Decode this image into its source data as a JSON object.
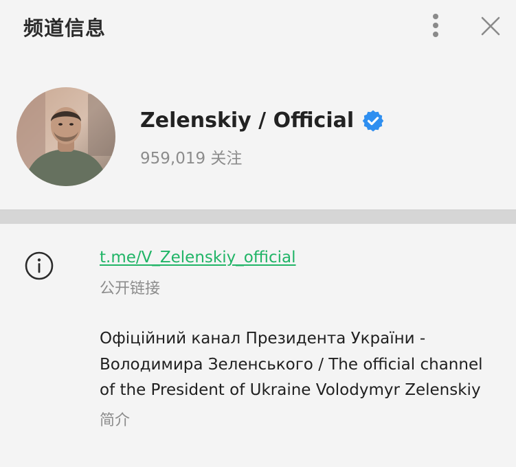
{
  "header": {
    "title": "频道信息",
    "more_icon": "more-vertical-icon",
    "close_icon": "close-icon"
  },
  "profile": {
    "name": "Zelenskiy / Official",
    "verified_icon": "verified-badge-icon",
    "subscribers": "959,019 关注"
  },
  "info": {
    "icon": "info-icon",
    "link": "t.me/V_Zelenskiy_official",
    "link_caption": "公开链接",
    "about": "Офіційний канал Президента України - Володимира Зеленського / The official channel of the President of Ukraine Volodymyr Zelenskiy",
    "about_caption": "简介"
  },
  "colors": {
    "background": "#f4f4f4",
    "divider": "#d6d6d6",
    "link": "#20b466",
    "verified": "#2f8ff0",
    "muted_text": "#8c8c8c"
  }
}
